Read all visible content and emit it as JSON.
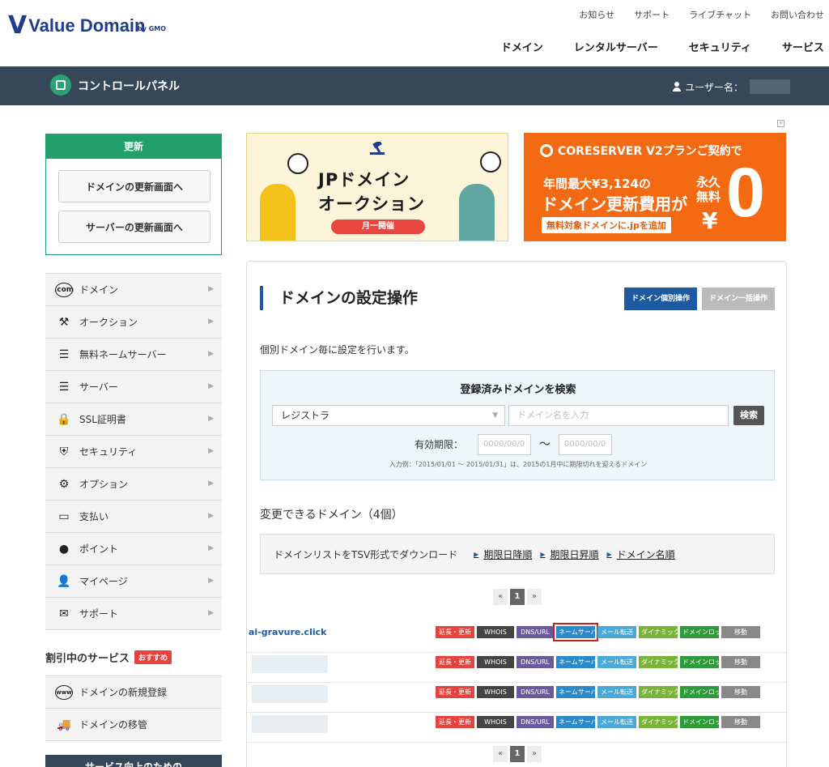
{
  "header": {
    "logo_text": "Value Domain",
    "logo_sub": "by GMO",
    "util_nav": [
      "お知らせ",
      "サポート",
      "ライブチャット",
      "お問い合わせ"
    ],
    "main_nav": [
      "ドメイン",
      "レンタルサーバー",
      "セキュリティ",
      "サービス"
    ]
  },
  "cp_bar": {
    "title": "コントロールパネル",
    "user_label": "ユーザー名："
  },
  "renew": {
    "heading": "更新",
    "domain_btn": "ドメインの更新画面へ",
    "server_btn": "サーバーの更新画面へ"
  },
  "side_menu": [
    {
      "label": "ドメイン",
      "icon": "com-icon",
      "glyph": ".com"
    },
    {
      "label": "オークション",
      "icon": "gavel-icon",
      "glyph": "⚒"
    },
    {
      "label": "無料ネームサーバー",
      "icon": "server-icon",
      "glyph": "☰"
    },
    {
      "label": "サーバー",
      "icon": "server-stack-icon",
      "glyph": "☰"
    },
    {
      "label": "SSL証明書",
      "icon": "lock-icon",
      "glyph": "🔒"
    },
    {
      "label": "セキュリティ",
      "icon": "shield-icon",
      "glyph": "⛨"
    },
    {
      "label": "オプション",
      "icon": "gear-icon",
      "glyph": "⚙"
    },
    {
      "label": "支払い",
      "icon": "card-icon",
      "glyph": "▭"
    },
    {
      "label": "ポイント",
      "icon": "coin-icon",
      "glyph": "●"
    },
    {
      "label": "マイページ",
      "icon": "user-icon",
      "glyph": "👤"
    },
    {
      "label": "サポート",
      "icon": "mail-icon",
      "glyph": "✉"
    }
  ],
  "discount": {
    "title": "割引中のサービス",
    "badge": "おすすめ",
    "items": [
      {
        "label": "ドメインの新規登録",
        "icon": "www-icon",
        "glyph": "www"
      },
      {
        "label": "ドメインの移管",
        "icon": "truck-icon",
        "glyph": "🚚"
      }
    ]
  },
  "side_bottom": "サービス向上のための",
  "banner_left": {
    "title_line1": "JPドメイン",
    "title_line2": "オークション",
    "pill": "月一開催"
  },
  "banner_right": {
    "top": "CORESERVER V2プランご契約で",
    "line1": "年間最大¥3,124の",
    "line2": "ドメイン更新費用が",
    "cta": "無料対象ドメインに.jpを追加",
    "eternal": "永久無料",
    "yen": "¥",
    "zero": "0"
  },
  "panel": {
    "title": "ドメインの設定操作",
    "tab_individual": "ドメイン個別操作",
    "tab_bulk": "ドメイン一括操作",
    "desc": "個別ドメイン毎に設定を行います。",
    "search": {
      "title": "登録済みドメインを検索",
      "select_value": "レジストラ",
      "domain_placeholder": "ドメイン名を入力",
      "search_btn": "検索",
      "exp_label": "有効期限：",
      "date_placeholder": "0000/00/0",
      "tilde": "〜",
      "example": "入力例：「2015/01/01 〜 2015/01/31」は、2015の1月中に期限切れを迎えるドメイン"
    },
    "changeable": "変更できるドメイン（4個）",
    "download": {
      "label": "ドメインリストをTSV形式でダウンロード",
      "links": [
        "期限日降順",
        "期限日昇順",
        "ドメイン名順"
      ]
    },
    "pager": {
      "prev": "«",
      "current": "1",
      "next": "»"
    },
    "actions": [
      "延長・更新",
      "WHOIS",
      "DNS/URL",
      "ネームサーバー",
      "メール転送",
      "ダイナミック",
      "ドメインロック",
      "移動"
    ],
    "domains": [
      {
        "name": "ai-gravure.click"
      },
      {
        "name": ""
      },
      {
        "name": ""
      },
      {
        "name": ""
      }
    ]
  }
}
